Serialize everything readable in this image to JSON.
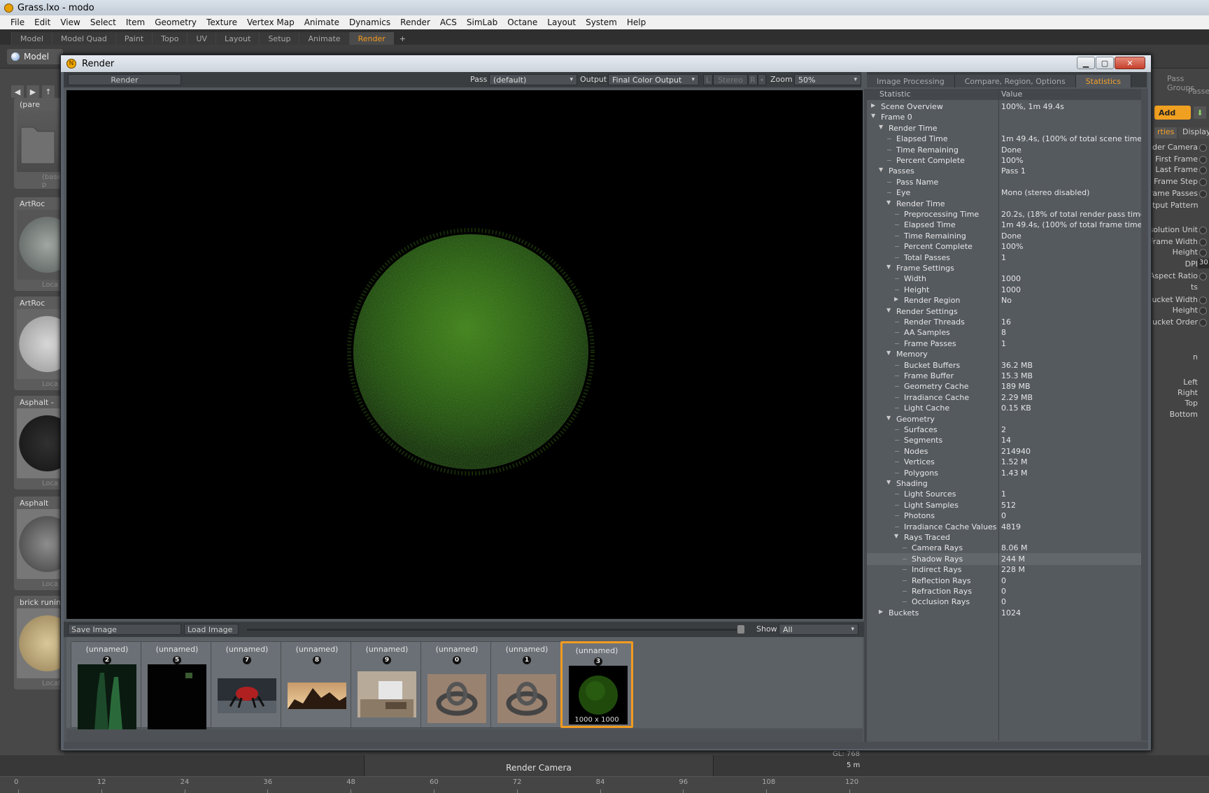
{
  "app": {
    "title": "Grass.lxo - modo"
  },
  "menu": [
    "File",
    "Edit",
    "View",
    "Select",
    "Item",
    "Geometry",
    "Texture",
    "Vertex Map",
    "Animate",
    "Dynamics",
    "Render",
    "ACS",
    "SimLab",
    "Octane",
    "Layout",
    "System",
    "Help"
  ],
  "layout_tabs": {
    "items": [
      "Model",
      "Model Quad",
      "Paint",
      "Topo",
      "UV",
      "Layout",
      "Setup",
      "Animate",
      "Render"
    ],
    "active": "Render",
    "add": "+"
  },
  "toolbar": {
    "mode_label": "Model"
  },
  "presets": [
    {
      "title": "(pare",
      "foot": "(base p"
    },
    {
      "title": "ArtRoc",
      "foot": "Loca"
    },
    {
      "title": "ArtRoc",
      "foot": "Loca"
    },
    {
      "title": "Asphalt -",
      "foot": "Loca"
    },
    {
      "title": "Asphalt",
      "foot": "Loca"
    },
    {
      "title": "brick runing",
      "foot": "Locator"
    }
  ],
  "right_panel": {
    "add_label": "Add",
    "tabs": [
      "rties",
      "Display"
    ],
    "labels": [
      "nder Camera",
      "First Frame",
      "Last Frame",
      "Frame Step",
      "rame Passes",
      "utput Pattern",
      "solution Unit",
      "Frame Width",
      "Height",
      "DPI",
      "Aspect Ratio",
      "ts",
      "ucket Width",
      "Height",
      "ucket Order",
      "n",
      "Left",
      "Right",
      "Top",
      "Bottom"
    ],
    "right_groups": [
      "Pass Groups",
      "Passes"
    ],
    "dpi_value": "30"
  },
  "render_window": {
    "title": "Render",
    "render_button": "Render",
    "pass_label": "Pass",
    "pass_value": "(default)",
    "output_label": "Output",
    "output_value": "Final Color Output",
    "stereo_L": "L",
    "stereo_label": "Stereo",
    "stereo_R": "R",
    "zoom_label": "Zoom",
    "zoom_value": "50%",
    "save_image": "Save Image",
    "load_image": "Load Image",
    "show_label": "Show",
    "show_value": "All",
    "thumbnails": [
      {
        "name": "(unnamed)",
        "num": "2",
        "kind": "bottles"
      },
      {
        "name": "(unnamed)",
        "num": "5",
        "kind": "dark"
      },
      {
        "name": "(unnamed)",
        "num": "7",
        "kind": "robot"
      },
      {
        "name": "(unnamed)",
        "num": "8",
        "kind": "terrain"
      },
      {
        "name": "(unnamed)",
        "num": "9",
        "kind": "room"
      },
      {
        "name": "(unnamed)",
        "num": "0",
        "kind": "knot"
      },
      {
        "name": "(unnamed)",
        "num": "1",
        "kind": "knot"
      },
      {
        "name": "(unnamed)",
        "num": "3",
        "kind": "grass",
        "caption": "1000 x 1000",
        "selected": true
      }
    ]
  },
  "stats_tabs": {
    "items": [
      "Image Processing",
      "Compare, Region, Options",
      "Statistics"
    ],
    "active": "Statistics"
  },
  "stats": {
    "col_statistic": "Statistic",
    "col_value": "Value",
    "rows": [
      {
        "label": "Scene Overview",
        "value": "100%, 1m 49.4s",
        "depth": 0,
        "tri": "right"
      },
      {
        "label": "Frame 0",
        "value": "",
        "depth": 0,
        "tri": "down"
      },
      {
        "label": "Render Time",
        "value": "",
        "depth": 1,
        "tri": "down"
      },
      {
        "label": "Elapsed Time",
        "value": "1m 49.4s, (100% of total scene time)",
        "depth": 2
      },
      {
        "label": "Time Remaining",
        "value": "Done",
        "depth": 2
      },
      {
        "label": "Percent Complete",
        "value": "100%",
        "depth": 2
      },
      {
        "label": "Passes",
        "value": "Pass 1",
        "depth": 1,
        "tri": "down"
      },
      {
        "label": "Pass Name",
        "value": "",
        "depth": 2
      },
      {
        "label": "Eye",
        "value": "Mono (stereo disabled)",
        "depth": 2
      },
      {
        "label": "Render Time",
        "value": "",
        "depth": 2,
        "tri": "down"
      },
      {
        "label": "Preprocessing Time",
        "value": "20.2s, (18% of total render pass time)",
        "depth": 3
      },
      {
        "label": "Elapsed Time",
        "value": "1m 49.4s, (100% of total frame time)",
        "depth": 3
      },
      {
        "label": "Time Remaining",
        "value": "Done",
        "depth": 3
      },
      {
        "label": "Percent Complete",
        "value": "100%",
        "depth": 3
      },
      {
        "label": "Total Passes",
        "value": "1",
        "depth": 3
      },
      {
        "label": "Frame Settings",
        "value": "",
        "depth": 2,
        "tri": "down"
      },
      {
        "label": "Width",
        "value": "1000",
        "depth": 3
      },
      {
        "label": "Height",
        "value": "1000",
        "depth": 3
      },
      {
        "label": "Render Region",
        "value": "No",
        "depth": 3,
        "tri": "right"
      },
      {
        "label": "Render Settings",
        "value": "",
        "depth": 2,
        "tri": "down"
      },
      {
        "label": "Render Threads",
        "value": "16",
        "depth": 3
      },
      {
        "label": "AA Samples",
        "value": "8",
        "depth": 3
      },
      {
        "label": "Frame Passes",
        "value": "1",
        "depth": 3
      },
      {
        "label": "Memory",
        "value": "",
        "depth": 2,
        "tri": "down"
      },
      {
        "label": "Bucket Buffers",
        "value": "36.2 MB",
        "depth": 3
      },
      {
        "label": "Frame Buffer",
        "value": "15.3 MB",
        "depth": 3
      },
      {
        "label": "Geometry Cache",
        "value": "189 MB",
        "depth": 3
      },
      {
        "label": "Irradiance Cache",
        "value": "2.29 MB",
        "depth": 3
      },
      {
        "label": "Light Cache",
        "value": "0.15 KB",
        "depth": 3
      },
      {
        "label": "Geometry",
        "value": "",
        "depth": 2,
        "tri": "down"
      },
      {
        "label": "Surfaces",
        "value": "2",
        "depth": 3
      },
      {
        "label": "Segments",
        "value": "14",
        "depth": 3
      },
      {
        "label": "Nodes",
        "value": "214940",
        "depth": 3
      },
      {
        "label": "Vertices",
        "value": "1.52 M",
        "depth": 3
      },
      {
        "label": "Polygons",
        "value": "1.43 M",
        "depth": 3
      },
      {
        "label": "Shading",
        "value": "",
        "depth": 2,
        "tri": "down"
      },
      {
        "label": "Light Sources",
        "value": "1",
        "depth": 3
      },
      {
        "label": "Light Samples",
        "value": "512",
        "depth": 3
      },
      {
        "label": "Photons",
        "value": "0",
        "depth": 3
      },
      {
        "label": "Irradiance Cache Values",
        "value": "4819",
        "depth": 3
      },
      {
        "label": "Rays Traced",
        "value": "",
        "depth": 3,
        "tri": "down"
      },
      {
        "label": "Camera Rays",
        "value": "8.06 M",
        "depth": 4
      },
      {
        "label": "Shadow Rays",
        "value": "244 M",
        "depth": 4,
        "hl": true
      },
      {
        "label": "Indirect Rays",
        "value": "228 M",
        "depth": 4
      },
      {
        "label": "Reflection Rays",
        "value": "0",
        "depth": 4
      },
      {
        "label": "Refraction Rays",
        "value": "0",
        "depth": 4
      },
      {
        "label": "Occlusion Rays",
        "value": "0",
        "depth": 4
      },
      {
        "label": "Buckets",
        "value": "1024",
        "depth": 1,
        "tri": "right"
      }
    ]
  },
  "viewport_bottom": {
    "camera_label": "Render Camera",
    "gl_label": "GL: 768",
    "distance": "5 m"
  },
  "timeline": {
    "ticks": [
      "0",
      "12",
      "24",
      "36",
      "48",
      "60",
      "72",
      "84",
      "96",
      "108",
      "120"
    ]
  }
}
